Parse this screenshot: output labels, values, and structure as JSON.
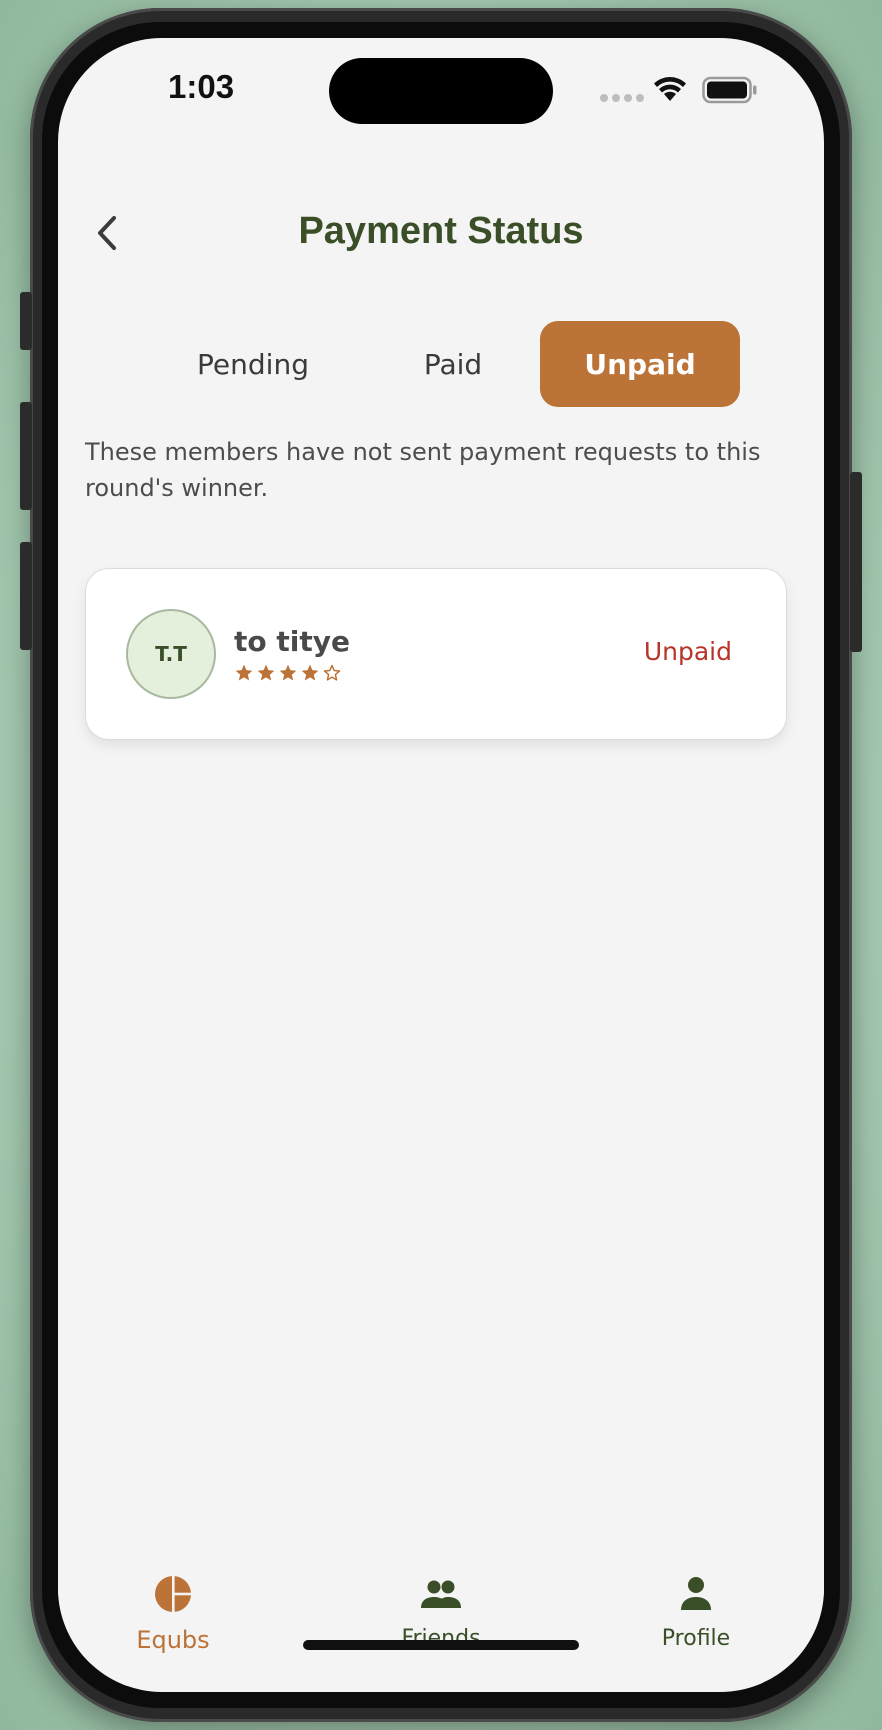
{
  "status_bar": {
    "time": "1:03"
  },
  "header": {
    "title": "Payment Status"
  },
  "tabs": [
    {
      "label": "Pending",
      "active": false
    },
    {
      "label": "Paid",
      "active": false
    },
    {
      "label": "Unpaid",
      "active": true
    }
  ],
  "description": "These members have not sent payment requests to this round's winner.",
  "members": [
    {
      "initials": "T.T",
      "name": "to titye",
      "rating": 4,
      "rating_max": 5,
      "status": "Unpaid"
    }
  ],
  "bottom_nav": [
    {
      "label": "Equbs",
      "icon": "pie-chart-icon",
      "active": true
    },
    {
      "label": "Friends",
      "icon": "people-icon",
      "active": false
    },
    {
      "label": "Profile",
      "icon": "person-icon",
      "active": false
    }
  ],
  "colors": {
    "accent": "#bb7337",
    "brand_green": "#3a4e27",
    "unpaid_red": "#b8342b",
    "background": "#f4f4f4"
  }
}
